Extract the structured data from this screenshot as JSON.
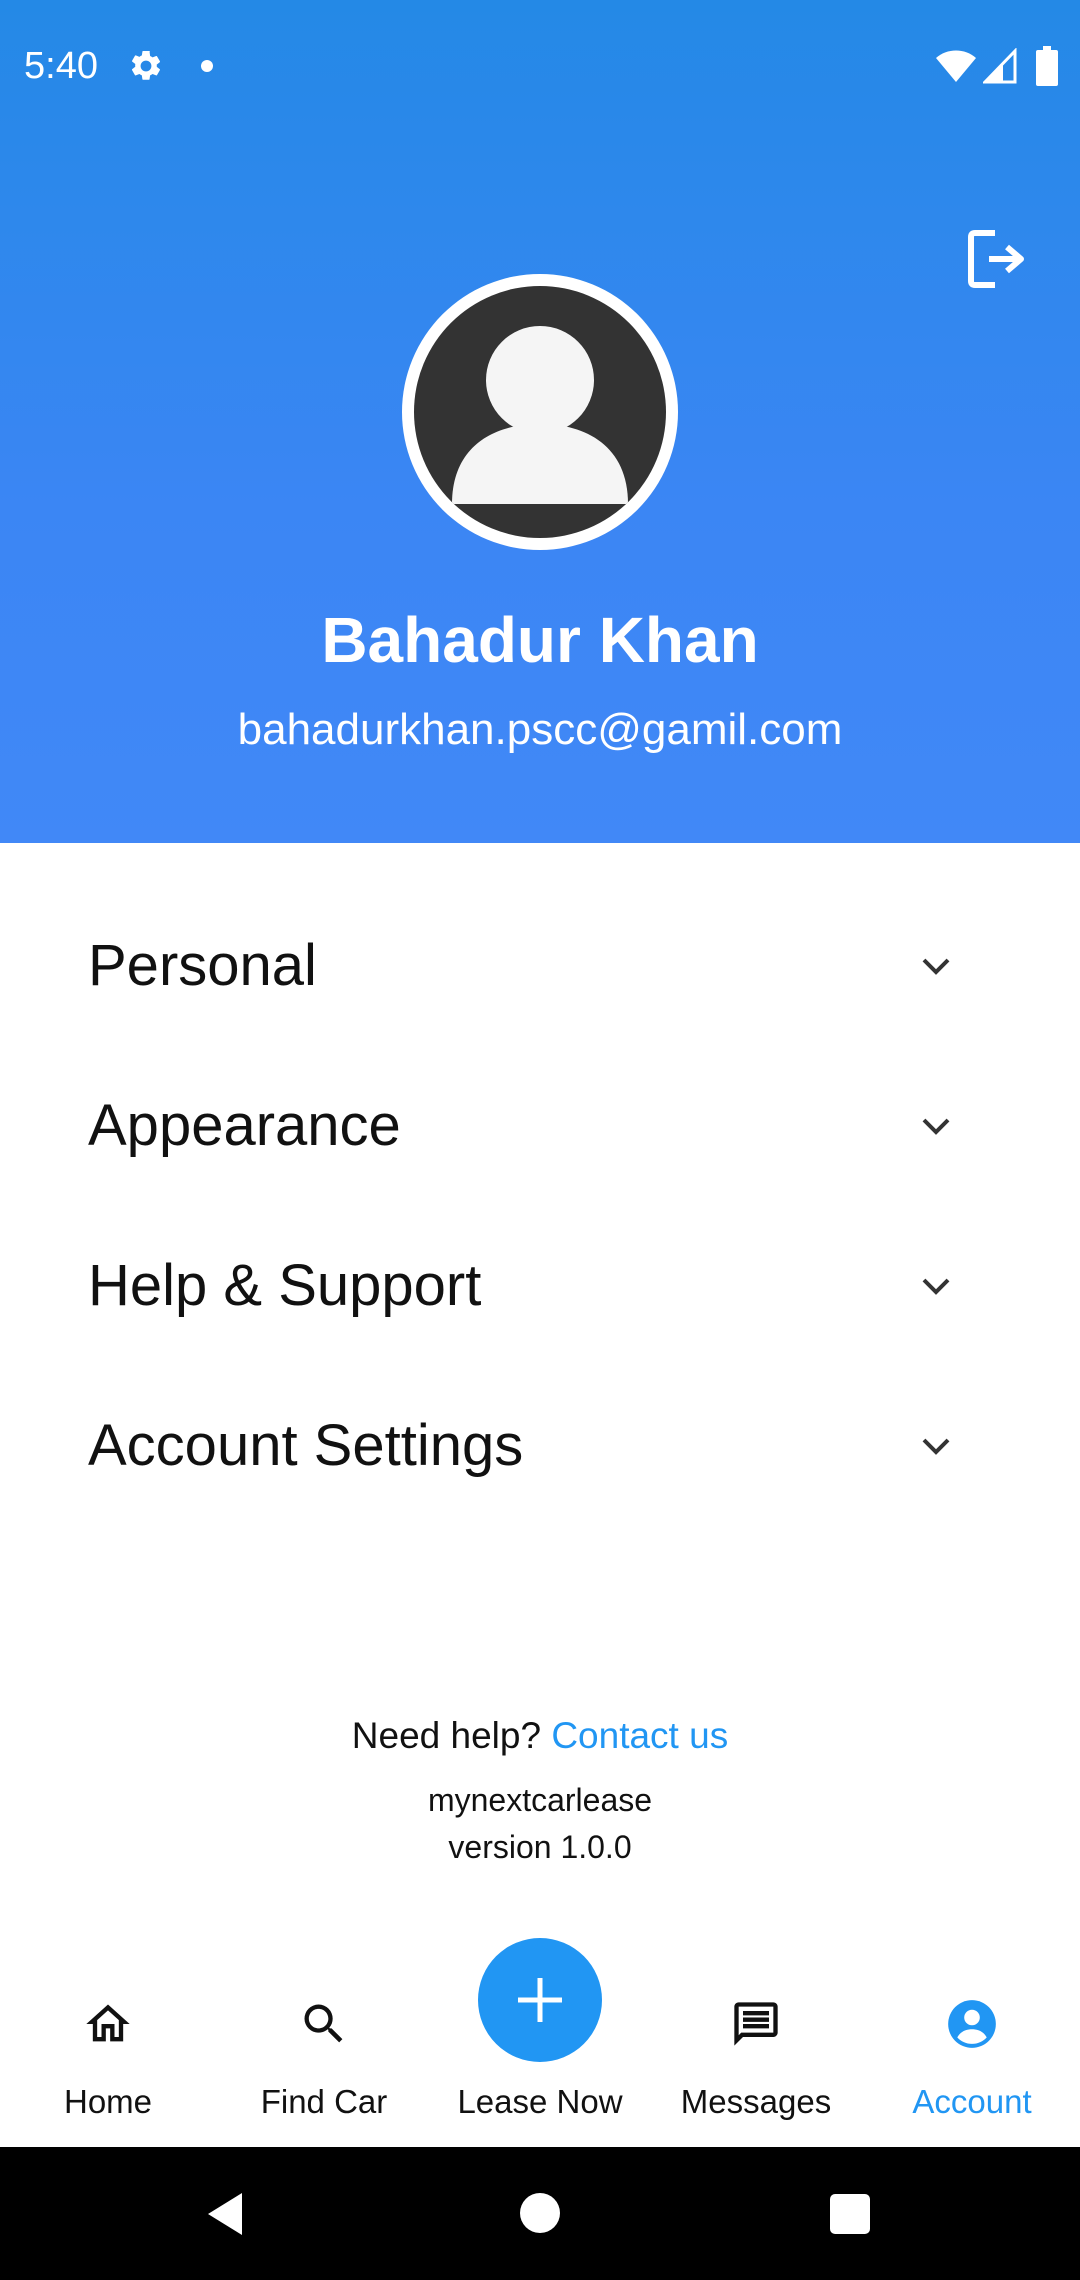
{
  "status_bar": {
    "time": "5:40",
    "icons": [
      "gear-icon",
      "notification-dot",
      "wifi-icon",
      "signal-icon",
      "battery-icon"
    ]
  },
  "header": {
    "logout_icon": "logout-icon",
    "avatar_icon": "account-avatar",
    "name": "Bahadur Khan",
    "email": "bahadurkhan.pscc@gamil.com",
    "gradient_top": "#2489e6",
    "gradient_bottom": "#4188f7"
  },
  "menu": {
    "items": [
      {
        "label": "Personal",
        "icon": "chevron-down-icon"
      },
      {
        "label": "Appearance",
        "icon": "chevron-down-icon"
      },
      {
        "label": "Help & Support",
        "icon": "chevron-down-icon"
      },
      {
        "label": "Account Settings",
        "icon": "chevron-down-icon"
      }
    ]
  },
  "footer": {
    "help_prompt": "Need help?",
    "contact_link": "Contact us",
    "app_name": "mynextcarlease",
    "version": "version 1.0.0"
  },
  "bottom_nav": {
    "items": [
      {
        "label": "Home",
        "icon": "home-icon"
      },
      {
        "label": "Find Car",
        "icon": "search-icon"
      },
      {
        "label": "Lease Now",
        "icon": "plus-icon"
      },
      {
        "label": "Messages",
        "icon": "message-icon"
      },
      {
        "label": "Account",
        "icon": "account-circle-icon"
      }
    ],
    "active": "Account",
    "accent_color": "#2196f3"
  },
  "system_nav": {
    "buttons": [
      "back",
      "home",
      "recents"
    ]
  }
}
